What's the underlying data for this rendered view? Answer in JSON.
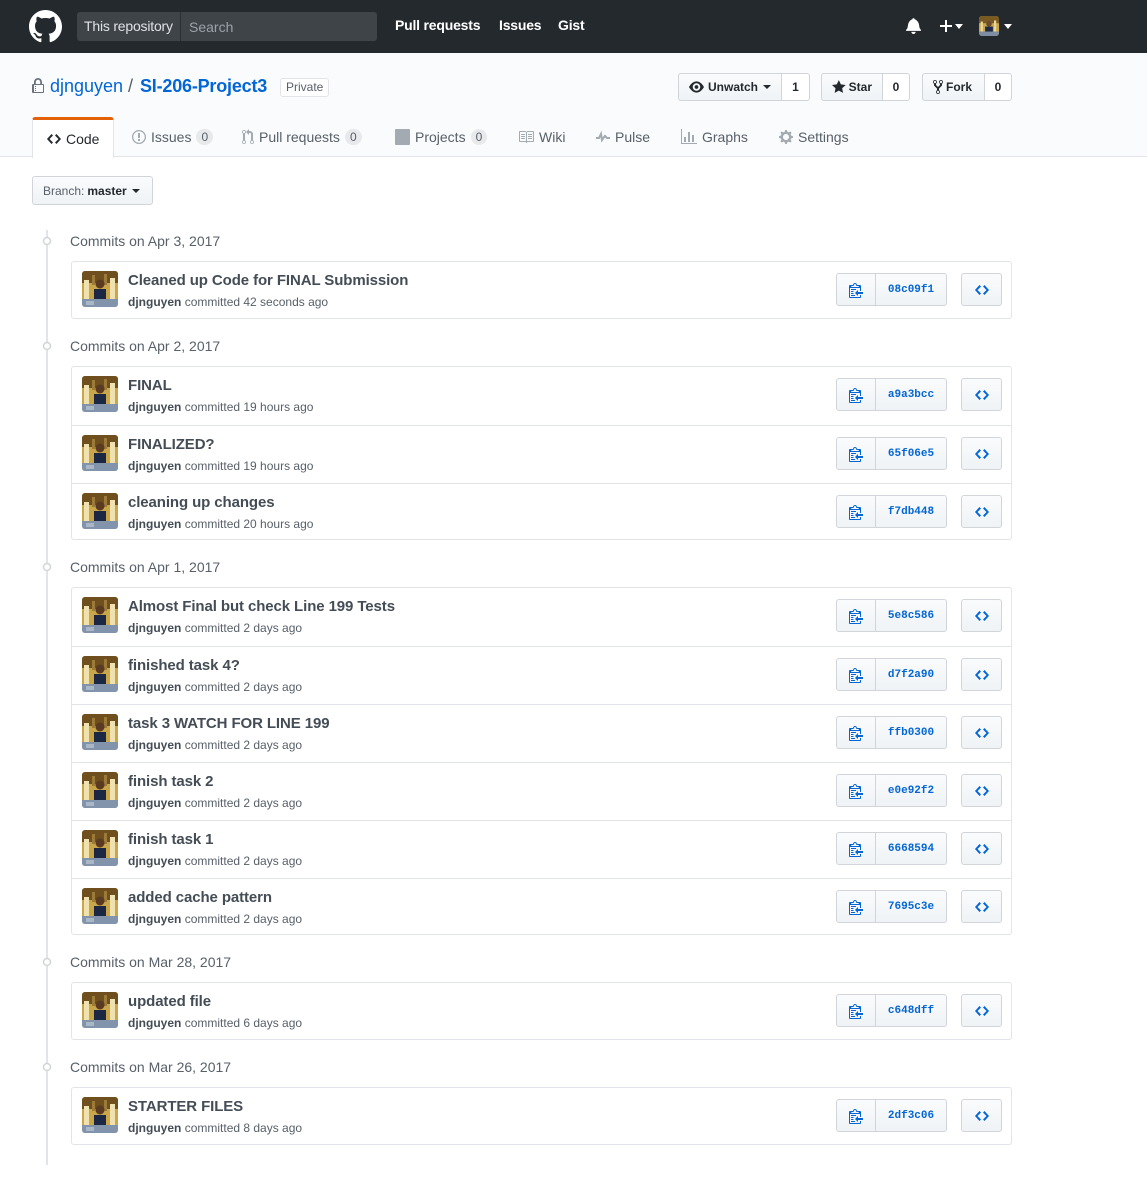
{
  "header": {
    "scope_label": "This repository",
    "search_placeholder": "Search",
    "nav": [
      "Pull requests",
      "Issues",
      "Gist"
    ]
  },
  "repo": {
    "owner": "djnguyen",
    "separator": "/",
    "name": "SI-206-Project3",
    "visibility": "Private",
    "watch": {
      "label": "Unwatch",
      "count": "1"
    },
    "star": {
      "label": "Star",
      "count": "0"
    },
    "fork": {
      "label": "Fork",
      "count": "0"
    }
  },
  "tabs": [
    {
      "label": "Code",
      "icon": "code-icon",
      "selected": true
    },
    {
      "label": "Issues",
      "count": "0",
      "icon": "issue-icon"
    },
    {
      "label": "Pull requests",
      "count": "0",
      "icon": "pull-request-icon"
    },
    {
      "label": "Projects",
      "count": "0",
      "icon": "project-icon"
    },
    {
      "label": "Wiki",
      "icon": "book-icon"
    },
    {
      "label": "Pulse",
      "icon": "pulse-icon"
    },
    {
      "label": "Graphs",
      "icon": "graph-icon"
    },
    {
      "label": "Settings",
      "icon": "gear-icon"
    }
  ],
  "branch": {
    "prefix": "Branch:",
    "name": "master"
  },
  "groups": [
    {
      "title": "Commits on Apr 3, 2017",
      "commits": [
        {
          "message": "Cleaned up Code for FINAL Submission",
          "author": "djnguyen",
          "time": "committed 42 seconds ago",
          "sha": "08c09f1"
        }
      ]
    },
    {
      "title": "Commits on Apr 2, 2017",
      "commits": [
        {
          "message": "FINAL",
          "author": "djnguyen",
          "time": "committed 19 hours ago",
          "sha": "a9a3bcc"
        },
        {
          "message": "FINALIZED?",
          "author": "djnguyen",
          "time": "committed 19 hours ago",
          "sha": "65f06e5"
        },
        {
          "message": "cleaning up changes",
          "author": "djnguyen",
          "time": "committed 20 hours ago",
          "sha": "f7db448"
        }
      ]
    },
    {
      "title": "Commits on Apr 1, 2017",
      "commits": [
        {
          "message": "Almost Final but check Line 199 Tests",
          "author": "djnguyen",
          "time": "committed 2 days ago",
          "sha": "5e8c586"
        },
        {
          "message": "finished task 4?",
          "author": "djnguyen",
          "time": "committed 2 days ago",
          "sha": "d7f2a90"
        },
        {
          "message": "task 3 WATCH FOR LINE 199",
          "author": "djnguyen",
          "time": "committed 2 days ago",
          "sha": "ffb0300"
        },
        {
          "message": "finish task 2",
          "author": "djnguyen",
          "time": "committed 2 days ago",
          "sha": "e0e92f2"
        },
        {
          "message": "finish task 1",
          "author": "djnguyen",
          "time": "committed 2 days ago",
          "sha": "6668594"
        },
        {
          "message": "added cache pattern",
          "author": "djnguyen",
          "time": "committed 2 days ago",
          "sha": "7695c3e"
        }
      ]
    },
    {
      "title": "Commits on Mar 28, 2017",
      "commits": [
        {
          "message": "updated file",
          "author": "djnguyen",
          "time": "committed 6 days ago",
          "sha": "c648dff"
        }
      ]
    },
    {
      "title": "Commits on Mar 26, 2017",
      "commits": [
        {
          "message": "STARTER FILES",
          "author": "djnguyen",
          "time": "committed 8 days ago",
          "sha": "2df3c06"
        }
      ]
    }
  ]
}
